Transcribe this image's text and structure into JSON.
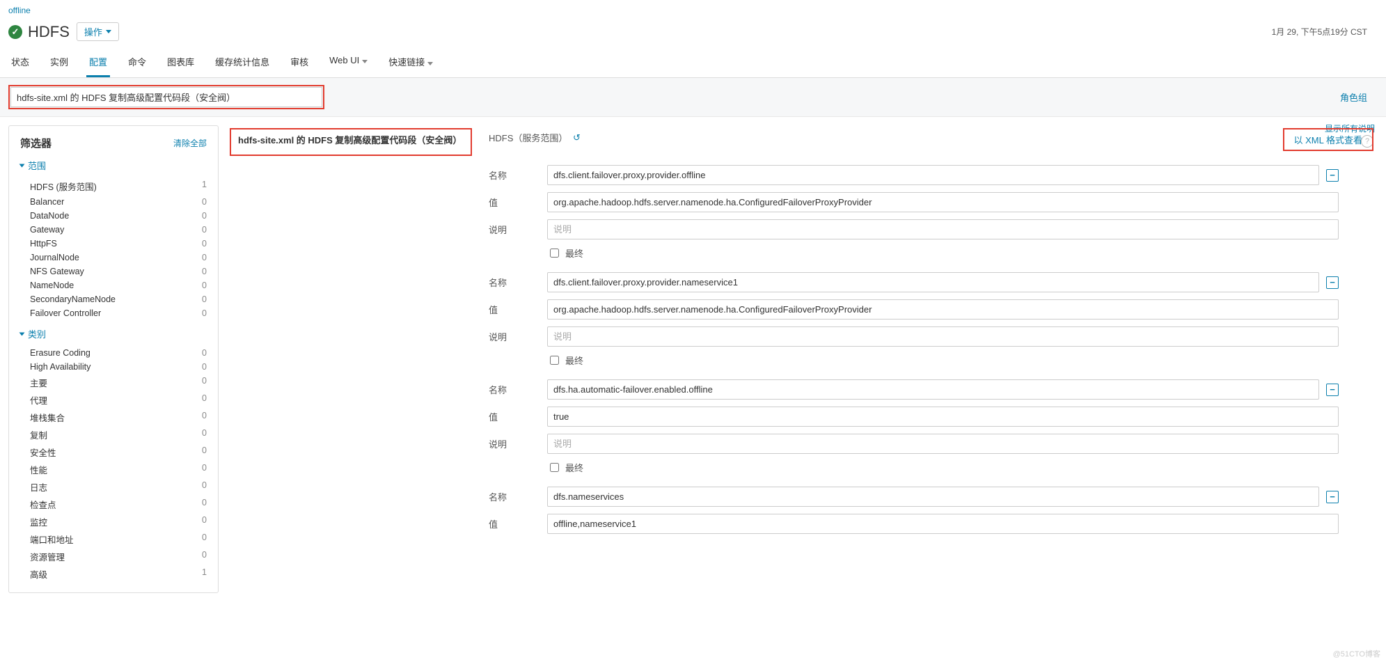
{
  "breadcrumb": "offline",
  "header": {
    "title": "HDFS",
    "ops_button": "操作",
    "timestamp": "1月 29, 下午5点19分 CST"
  },
  "tabs": [
    "状态",
    "实例",
    "配置",
    "命令",
    "图表库",
    "缓存统计信息",
    "审核",
    "Web UI",
    "快速链接"
  ],
  "active_tab_index": 2,
  "dropdown_tab_indices": [
    7,
    8
  ],
  "toolbar": {
    "search_value": "hdfs-site.xml 的 HDFS 复制高级配置代码段（安全阀）",
    "role_group": "角色组"
  },
  "sidebar": {
    "title": "筛选器",
    "clear_all": "清除全部",
    "groups": [
      {
        "title": "范围",
        "items": [
          {
            "label": "HDFS (服务范围)",
            "count": 1
          },
          {
            "label": "Balancer",
            "count": 0
          },
          {
            "label": "DataNode",
            "count": 0
          },
          {
            "label": "Gateway",
            "count": 0
          },
          {
            "label": "HttpFS",
            "count": 0
          },
          {
            "label": "JournalNode",
            "count": 0
          },
          {
            "label": "NFS Gateway",
            "count": 0
          },
          {
            "label": "NameNode",
            "count": 0
          },
          {
            "label": "SecondaryNameNode",
            "count": 0
          },
          {
            "label": "Failover Controller",
            "count": 0
          }
        ]
      },
      {
        "title": "类别",
        "items": [
          {
            "label": "Erasure Coding",
            "count": 0
          },
          {
            "label": "High Availability",
            "count": 0
          },
          {
            "label": "主要",
            "count": 0
          },
          {
            "label": "代理",
            "count": 0
          },
          {
            "label": "堆栈集合",
            "count": 0
          },
          {
            "label": "复制",
            "count": 0
          },
          {
            "label": "安全性",
            "count": 0
          },
          {
            "label": "性能",
            "count": 0
          },
          {
            "label": "日志",
            "count": 0
          },
          {
            "label": "检查点",
            "count": 0
          },
          {
            "label": "监控",
            "count": 0
          },
          {
            "label": "端口和地址",
            "count": 0
          },
          {
            "label": "资源管理",
            "count": 0
          },
          {
            "label": "高级",
            "count": 1
          }
        ]
      }
    ]
  },
  "main": {
    "show_all": "显示所有说明",
    "config_label": "hdfs-site.xml 的 HDFS 复制高级配置代码段（安全阀）",
    "scope_text": "HDFS（服务范围）",
    "view_xml": "以 XML 格式查看",
    "field_labels": {
      "name": "名称",
      "value": "值",
      "desc": "说明",
      "final": "最终"
    },
    "desc_placeholder": "说明",
    "properties": [
      {
        "name": "dfs.client.failover.proxy.provider.offline",
        "value": "org.apache.hadoop.hdfs.server.namenode.ha.ConfiguredFailoverProxyProvider"
      },
      {
        "name": "dfs.client.failover.proxy.provider.nameservice1",
        "value": "org.apache.hadoop.hdfs.server.namenode.ha.ConfiguredFailoverProxyProvider"
      },
      {
        "name": "dfs.ha.automatic-failover.enabled.offline",
        "value": "true"
      },
      {
        "name": "dfs.nameservices",
        "value": "offline,nameservice1"
      }
    ]
  },
  "watermark": "@51CTO博客"
}
